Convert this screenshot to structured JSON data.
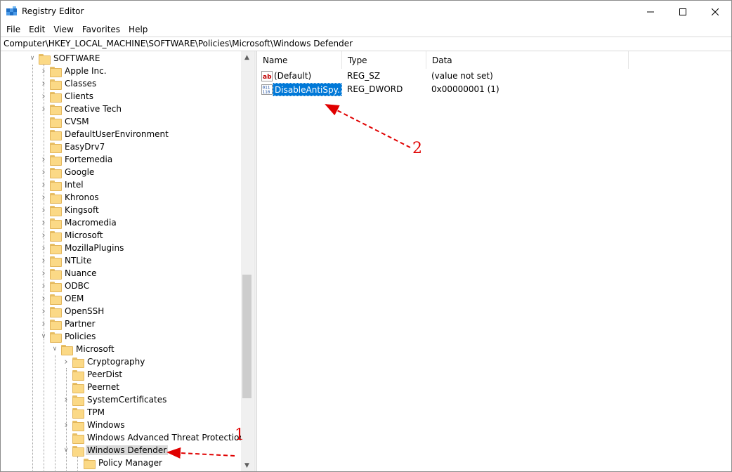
{
  "window": {
    "title": "Registry Editor"
  },
  "menu": [
    "File",
    "Edit",
    "View",
    "Favorites",
    "Help"
  ],
  "address": "Computer\\HKEY_LOCAL_MACHINE\\SOFTWARE\\Policies\\Microsoft\\Windows Defender",
  "tree": {
    "root": "SOFTWARE",
    "items": [
      "Apple Inc.",
      "Classes",
      "Clients",
      "Creative Tech",
      "CVSM",
      "DefaultUserEnvironment",
      "EasyDrv7",
      "Fortemedia",
      "Google",
      "Intel",
      "Khronos",
      "Kingsoft",
      "Macromedia",
      "Microsoft",
      "MozillaPlugins",
      "NTLite",
      "Nuance",
      "ODBC",
      "OEM",
      "OpenSSH",
      "Partner",
      "Policies"
    ],
    "policies_child": "Microsoft",
    "microsoft_children": [
      "Cryptography",
      "PeerDist",
      "Peernet",
      "SystemCertificates",
      "TPM",
      "Windows",
      "Windows Advanced Threat Protection",
      "Windows Defender"
    ],
    "defender_child": "Policy Manager"
  },
  "list": {
    "columns": [
      "Name",
      "Type",
      "Data"
    ],
    "rows": [
      {
        "name": "(Default)",
        "type": "REG_SZ",
        "data": "(value not set)",
        "icon": "string-value-icon"
      },
      {
        "name": "DisableAntiSpy...",
        "type": "REG_DWORD",
        "data": "0x00000001 (1)",
        "icon": "binary-value-icon"
      }
    ]
  },
  "annotations": {
    "step1": "1",
    "step2": "2"
  },
  "colors": {
    "selection": "#0078d7",
    "annotation": "#e00000",
    "folder": "#fbd986"
  }
}
